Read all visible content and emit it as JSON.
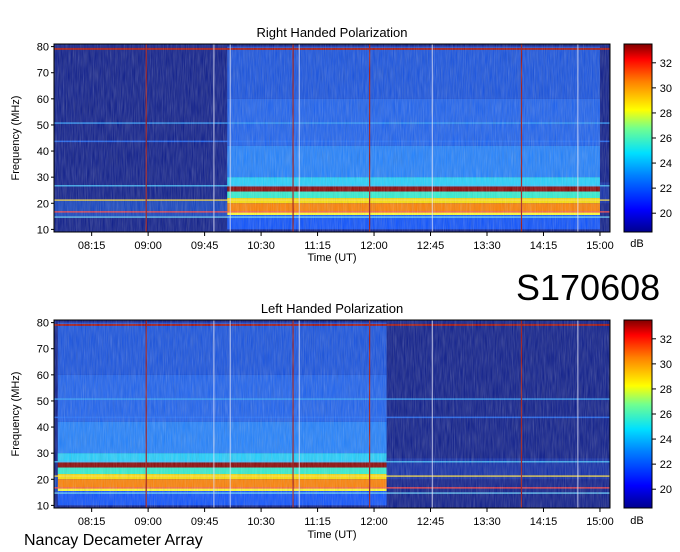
{
  "station": "Nancay Decameter Array",
  "observation_id": "S170608",
  "colors": {
    "background": "#0a1a8a",
    "burst_red": "#a01010",
    "line_white": "#e8e8ff"
  },
  "chart_data": [
    {
      "type": "heatmap",
      "title": "Right Handed Polarization",
      "xlabel": "Time (UT)",
      "ylabel": "Frequency (MHz)",
      "x_ticks": [
        "08:15",
        "09:00",
        "09:45",
        "10:30",
        "11:15",
        "12:00",
        "12:45",
        "13:30",
        "14:15",
        "15:00"
      ],
      "y_ticks": [
        10,
        20,
        30,
        40,
        50,
        60,
        70,
        80
      ],
      "ylim": [
        10,
        80
      ],
      "colorbar": {
        "unit": "dB",
        "ticks": [
          20,
          22,
          24,
          26,
          28,
          30,
          32
        ],
        "range": [
          18.5,
          33.5
        ]
      },
      "active_interval": [
        "10:03",
        "15:00"
      ]
    },
    {
      "type": "heatmap",
      "title": "Left Handed Polarization",
      "xlabel": "Time (UT)",
      "ylabel": "Frequency (MHz)",
      "x_ticks": [
        "08:15",
        "09:00",
        "09:45",
        "10:30",
        "11:15",
        "12:00",
        "12:45",
        "13:30",
        "14:15",
        "15:00"
      ],
      "y_ticks": [
        10,
        20,
        30,
        40,
        50,
        60,
        70,
        80
      ],
      "ylim": [
        10,
        80
      ],
      "colorbar": {
        "unit": "dB",
        "ticks": [
          20,
          22,
          24,
          26,
          28,
          30,
          32
        ],
        "range": [
          18.5,
          33.5
        ]
      },
      "active_interval": [
        "07:48",
        "12:10"
      ]
    }
  ]
}
